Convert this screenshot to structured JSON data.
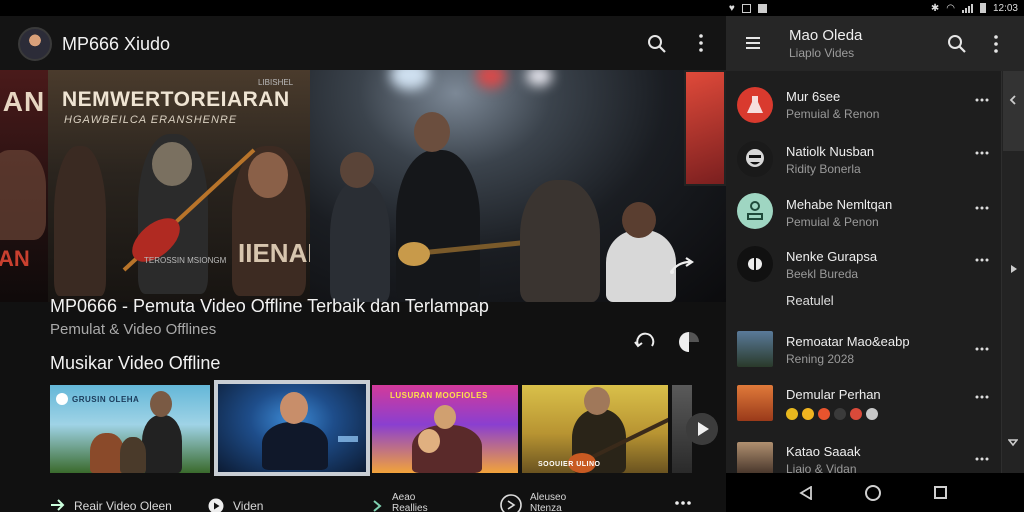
{
  "status_bar": {
    "time": "12:03",
    "icons": [
      "heart-icon",
      "image-icon",
      "photo-icon",
      "bluetooth-icon",
      "wifi-icon",
      "signal-icon",
      "battery-icon"
    ]
  },
  "app": {
    "title": "MP666 Xiudo",
    "icons": [
      "avatar",
      "search-icon",
      "more-vert-icon"
    ]
  },
  "hero": {
    "poster_a": {
      "text_top": "IAN",
      "text_bottom": "AN"
    },
    "poster_b": {
      "corner_text": "LIBISHEL",
      "headline": "NEMWERTOREIARAN",
      "tagline": "HGAWBEILCA ERANSHENRE",
      "caption": "TEROSSIN MSIONGM",
      "footer_word": "IIENAN"
    },
    "share_icon": "share-icon"
  },
  "video": {
    "title": "MP0666 - Pemuta Video Offline Terbaik dan Terlampap",
    "subtitle": "Pemulat & Video Offlines",
    "actions": [
      "repeat-icon",
      "volume-icon"
    ]
  },
  "section": {
    "title": "Musikar Video Offline",
    "thumbnails": [
      {
        "label": "Reair Video Oleen",
        "icon": "arrow-right-icon",
        "poster_text": "GRUSIN OLEHA"
      },
      {
        "label": "Viden",
        "icon": "play-circle-icon",
        "selected": true
      },
      {
        "label_line1": "Aeao",
        "label_line2": "Reallies",
        "icon": "chevron-right-icon",
        "poster_text": "LUSURAN MOOFIOLES"
      },
      {
        "label_line1": "Aleuseo",
        "label_line2": "Ntenza",
        "icon": "replay-circle-icon",
        "poster_text": "SOOUIER ULINO"
      },
      {
        "label": "",
        "icon": ""
      }
    ],
    "next_icon": "play-next-icon",
    "more_icon": "more-horiz-icon"
  },
  "panel": {
    "title": "Mao Oleda",
    "subtitle": "Liaplo Vides",
    "items": [
      {
        "name": "Mur 6see",
        "sub": "Pemuial & Renon",
        "avatar_color": "#d93a2e",
        "avatar_icon": "flask-icon"
      },
      {
        "name": "Natiolk Nusban",
        "sub": "Ridity Bonerla",
        "avatar_color": "#1a1a1a",
        "avatar_icon": "face-icon"
      },
      {
        "name": "Mehabe Nemltqan",
        "sub": "Pemuial & Penon",
        "avatar_color": "#9fd6c2",
        "avatar_icon": "person-icon"
      },
      {
        "name": "Nenke Gurapsa",
        "sub": "Beekl Bureda",
        "extra": "Reatulel",
        "avatar_color": "#111111",
        "avatar_icon": "pause-icon"
      },
      {
        "name": "Remoatar Mao&eabp",
        "sub": "Rening 2028",
        "avatar_color": "#3a5a3a",
        "avatar_icon": ""
      },
      {
        "name": "Demular Perhan",
        "sub": "",
        "avatar_color": "#d1572e",
        "avatar_icon": "",
        "swatches": [
          "#e8b81e",
          "#f0b420",
          "#e8542e",
          "#3a3a3a",
          "#d94a3a",
          "#c8c8c8"
        ]
      },
      {
        "name": "Katao Saaak",
        "sub": "Liaio & Vidan",
        "avatar_color": "#6a4a3a",
        "avatar_icon": ""
      }
    ],
    "scroll_icons": [
      "chevron-up-icon",
      "chevron-right-icon",
      "chevron-down-icon"
    ]
  },
  "nav": {
    "icons": [
      "back-icon",
      "home-icon",
      "recents-icon"
    ]
  }
}
